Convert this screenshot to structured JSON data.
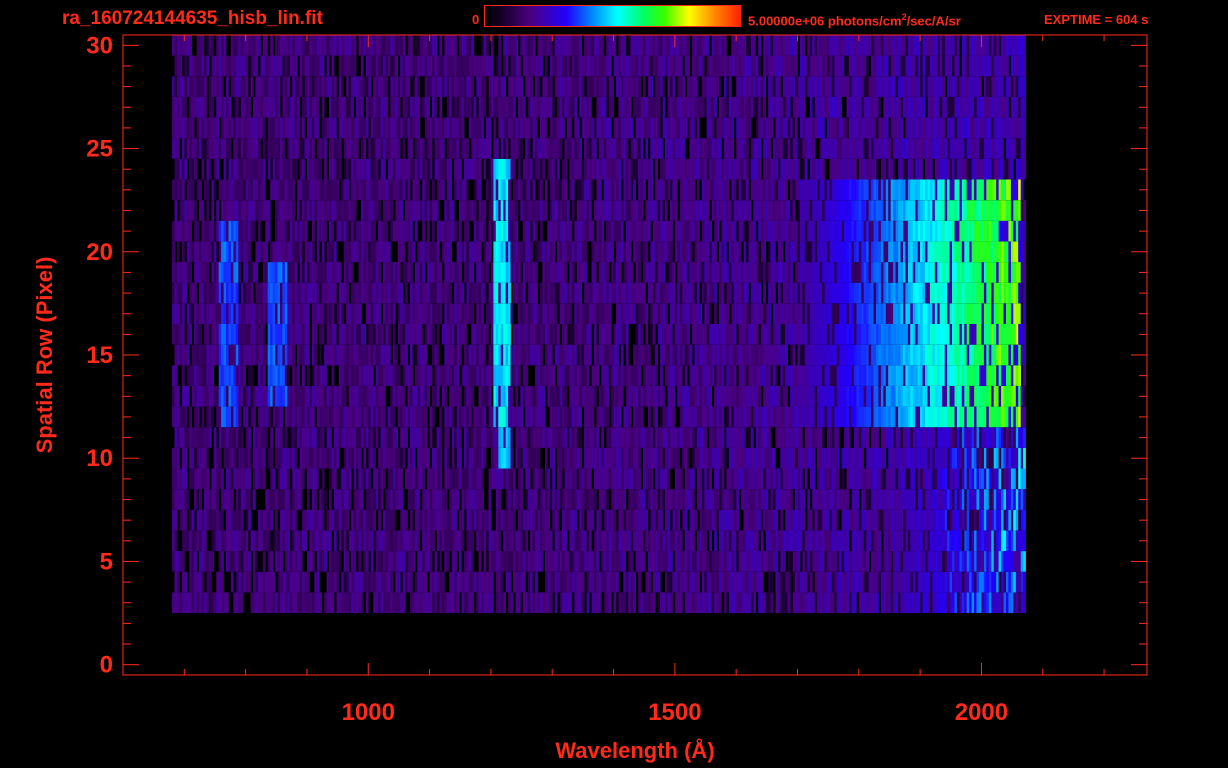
{
  "header": {
    "file_title": "ra_160724144635_hisb_lin.fit",
    "colorbar_min": "0",
    "colorbar_max": "5.00000e+06 photons/cm",
    "colorbar_max_sup": "2",
    "colorbar_max_tail": "/sec/A/sr",
    "exptime": "EXPTIME = 604 s"
  },
  "colors": {
    "axis": "#ff2a1a",
    "background": "#000000"
  },
  "chart_data": {
    "type": "heatmap",
    "title": "ra_160724144635_hisb_lin.fit",
    "xlabel": "Wavelength (Å)",
    "ylabel": "Spatial Row (Pixel)",
    "xlim": [
      600,
      2270
    ],
    "ylim": [
      -0.5,
      30.5
    ],
    "x_ticks": [
      1000,
      1500,
      2000
    ],
    "x_ticklabels": [
      "1000",
      "1500",
      "2000"
    ],
    "y_ticks": [
      0,
      5,
      10,
      15,
      20,
      25,
      30
    ],
    "y_ticklabels": [
      "0",
      "5",
      "10",
      "15",
      "20",
      "25",
      "30"
    ],
    "colorbar": {
      "min": 0,
      "max": 5000000,
      "units": "photons/cm^2/sec/A/sr",
      "colormap": "rainbow"
    },
    "data_extent": {
      "x_min": 680,
      "x_max": 2070,
      "row_min": 3,
      "row_max": 30
    },
    "features": [
      {
        "wavelength": 1216,
        "rows": [
          10,
          24
        ],
        "peak_fraction": 0.55
      },
      {
        "wavelength": 770,
        "rows": [
          12,
          21
        ],
        "peak_fraction": 0.42
      },
      {
        "wavelength": 850,
        "rows": [
          13,
          19
        ],
        "peak_fraction": 0.42
      }
    ],
    "continuum": {
      "rows": [
        12,
        23
      ],
      "start_wavelength": 1700,
      "end_wavelength": 2060,
      "peak_fraction": 0.6
    },
    "grid": false
  }
}
